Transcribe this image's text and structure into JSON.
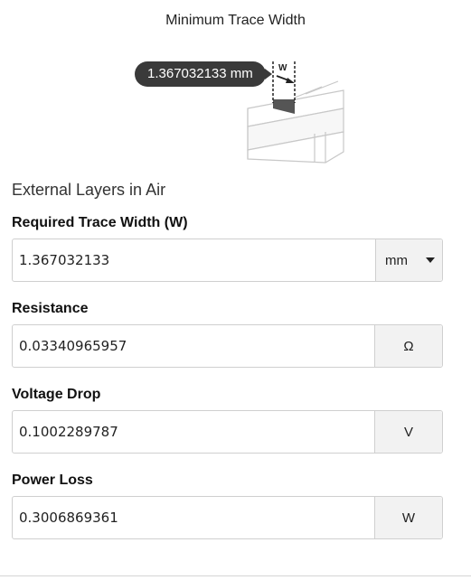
{
  "title": "Minimum Trace Width",
  "diagram": {
    "tooltip_value": "1.367032133 mm",
    "width_label": "W"
  },
  "section_heading": "External Layers in Air",
  "fields": {
    "trace_width": {
      "label": "Required Trace Width (W)",
      "value": "1.367032133",
      "unit": "mm"
    },
    "resistance": {
      "label": "Resistance",
      "value": "0.03340965957",
      "unit": "Ω"
    },
    "voltage_drop": {
      "label": "Voltage Drop",
      "value": "0.1002289787",
      "unit": "V"
    },
    "power_loss": {
      "label": "Power Loss",
      "value": "0.3006869361",
      "unit": "W"
    }
  }
}
